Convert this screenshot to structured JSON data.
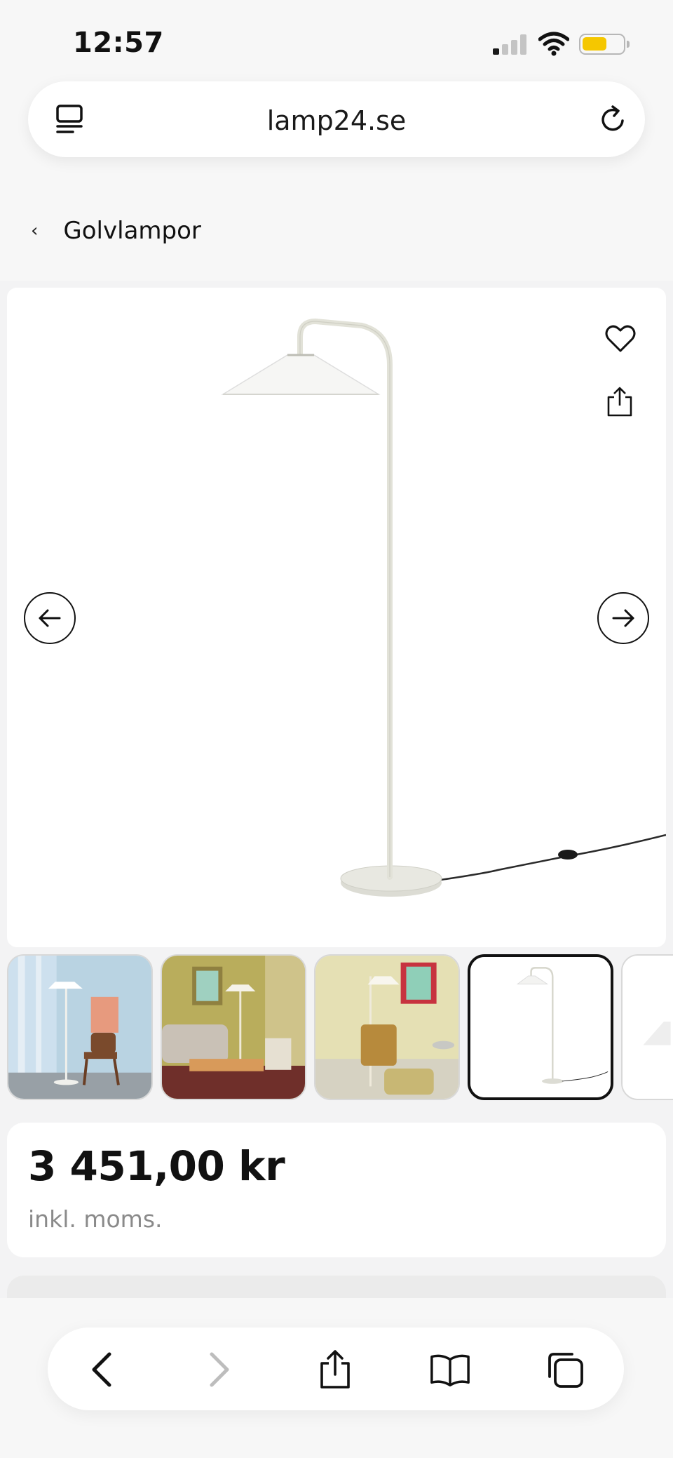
{
  "status_bar": {
    "time": "12:57",
    "battery_level": 0.55,
    "battery_color": "#f5c700",
    "signal_bars_on": 1,
    "icons": [
      "cellular-signal-icon",
      "wifi-icon",
      "battery-icon"
    ]
  },
  "browser": {
    "url": "lamp24.se",
    "left_icon": "reader-mode-icon",
    "right_icon": "reload-icon"
  },
  "breadcrumb": {
    "back_icon": "chevron-left-icon",
    "label": "Golvlampor"
  },
  "gallery": {
    "main_image": "floor-lamp-product-photo",
    "actions": [
      "heart-icon",
      "share-icon"
    ],
    "nav": [
      "arrow-left-icon",
      "arrow-right-icon"
    ],
    "thumbnails": [
      {
        "subject": "lamp-with-wooden-chair-blue-room",
        "selected": false
      },
      {
        "subject": "lamp-in-living-room-with-sofa",
        "selected": false
      },
      {
        "subject": "lamp-with-armchair-yellow-room",
        "selected": false
      },
      {
        "subject": "lamp-product-photo",
        "selected": true
      },
      {
        "subject": "lamp-shade-closeup",
        "selected": false
      }
    ]
  },
  "price_card": {
    "price": "3 451,00 kr",
    "vat_note": "inkl. moms."
  },
  "toolbar": {
    "buttons": [
      "back-icon",
      "forward-icon",
      "share-icon",
      "bookmarks-icon",
      "tabs-icon"
    ],
    "forward_enabled": false
  },
  "colors": {
    "text": "#111111",
    "muted": "#8a8a8a",
    "page_bg": "#f3f3f4",
    "card_bg": "#ffffff"
  }
}
